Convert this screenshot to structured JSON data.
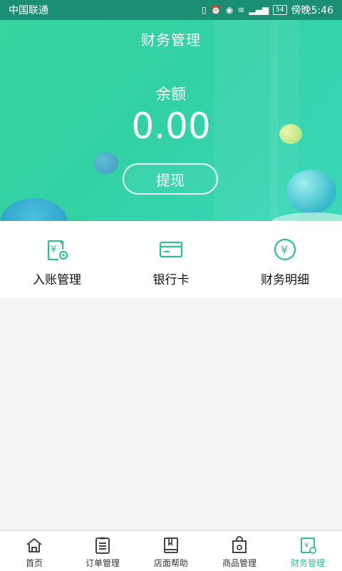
{
  "status": {
    "carrier": "中国联通",
    "battery": "54",
    "time": "傍晚5:46"
  },
  "header": {
    "title": "财务管理"
  },
  "balance": {
    "label": "余额",
    "value": "0.00",
    "withdraw_label": "提现"
  },
  "menu": [
    {
      "label": "入账管理",
      "icon": "receipt-gear-icon"
    },
    {
      "label": "银行卡",
      "icon": "bank-card-icon"
    },
    {
      "label": "财务明细",
      "icon": "yen-circle-icon"
    }
  ],
  "tabbar": [
    {
      "label": "首页",
      "icon": "home-icon"
    },
    {
      "label": "订单管理",
      "icon": "order-list-icon"
    },
    {
      "label": "店面帮助",
      "icon": "book-icon"
    },
    {
      "label": "商品管理",
      "icon": "bag-icon"
    },
    {
      "label": "财务管理",
      "icon": "finance-icon",
      "active": true
    }
  ],
  "colors": {
    "accent": "#2fbf98",
    "header_bg": "#37d3a0",
    "status_bg": "#1b8f73"
  }
}
